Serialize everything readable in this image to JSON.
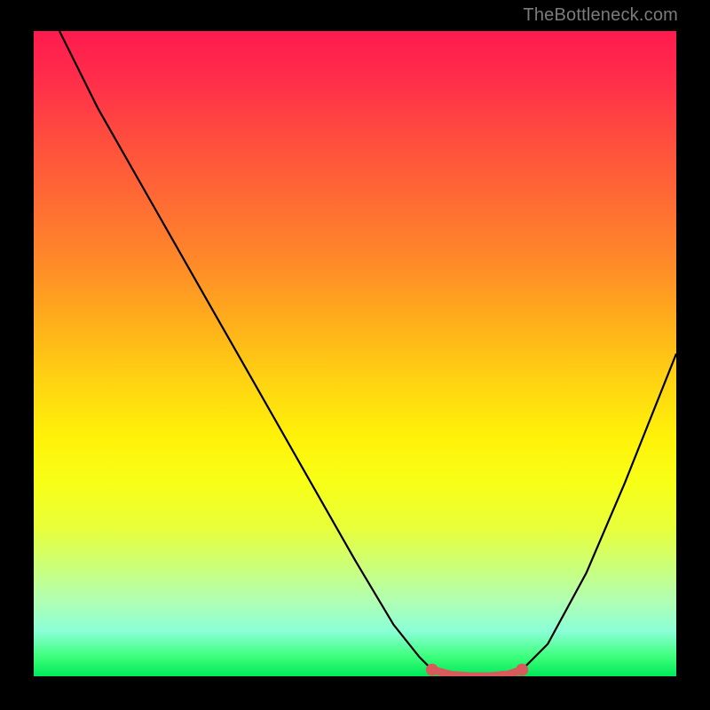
{
  "watermark": "TheBottleneck.com",
  "colors": {
    "curve": "#000000",
    "marker": "#d85a5a",
    "frame_bg": "#000000"
  },
  "chart_data": {
    "type": "line",
    "title": "",
    "xlabel": "",
    "ylabel": "",
    "xlim": [
      0,
      100
    ],
    "ylim": [
      0,
      100
    ],
    "grid": false,
    "series": [
      {
        "name": "curve",
        "x": [
          4,
          10,
          18,
          26,
          34,
          42,
          50,
          56,
          60,
          62,
          65,
          70,
          74,
          76,
          80,
          86,
          92,
          100
        ],
        "y": [
          100,
          88,
          74,
          60,
          46,
          32,
          18,
          8,
          3,
          1,
          0,
          0,
          0,
          1,
          5,
          16,
          30,
          50
        ]
      }
    ],
    "markers": [
      {
        "name": "flat-region-left-end",
        "x": 62,
        "y": 1
      },
      {
        "name": "flat-region-right-end",
        "x": 76,
        "y": 1
      }
    ],
    "highlight_segment": {
      "name": "flat-bottom",
      "x": [
        62,
        65,
        68,
        71,
        74,
        76
      ],
      "y": [
        1,
        0.2,
        0,
        0,
        0.3,
        1
      ]
    }
  }
}
